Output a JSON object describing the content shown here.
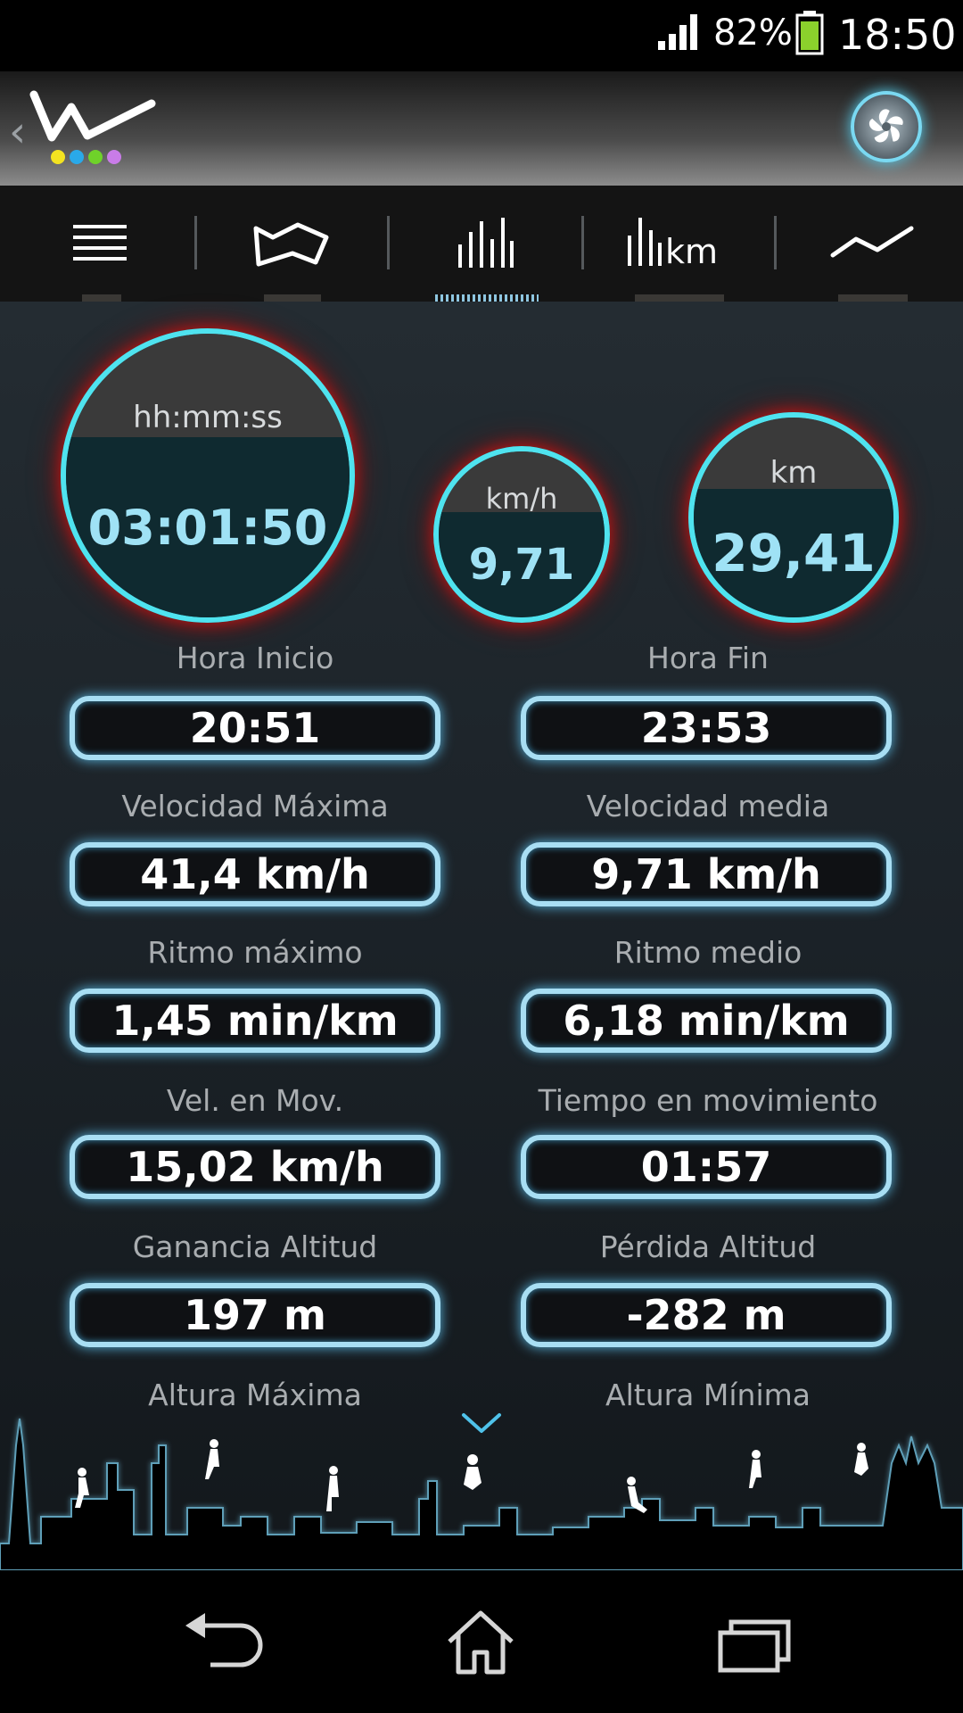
{
  "status_bar": {
    "battery_percent": "82%",
    "time": "18:50"
  },
  "tabs": [
    {
      "name": "list",
      "icon": "list-icon",
      "active": false
    },
    {
      "name": "map",
      "icon": "map-icon",
      "active": false
    },
    {
      "name": "bars",
      "icon": "bar-chart-icon",
      "active": true
    },
    {
      "name": "bars-km",
      "icon": "bar-chart-km-icon",
      "active": false,
      "label": "km"
    },
    {
      "name": "line",
      "icon": "line-chart-icon",
      "active": false
    }
  ],
  "gauges": {
    "time": {
      "unit": "hh:mm:ss",
      "value": "03:01:50"
    },
    "speed": {
      "unit": "km/h",
      "value": "9,71"
    },
    "distance": {
      "unit": "km",
      "value": "29,41"
    }
  },
  "stats": {
    "hora_inicio": {
      "label": "Hora Inicio",
      "value": "20:51"
    },
    "hora_fin": {
      "label": "Hora Fin",
      "value": "23:53"
    },
    "velocidad_maxima": {
      "label": "Velocidad Máxima",
      "value": "41,4 km/h"
    },
    "velocidad_media": {
      "label": "Velocidad media",
      "value": "9,71 km/h"
    },
    "ritmo_maximo": {
      "label": "Ritmo máximo",
      "value": "1,45 min/km"
    },
    "ritmo_medio": {
      "label": "Ritmo medio",
      "value": "6,18 min/km"
    },
    "vel_en_mov": {
      "label": "Vel. en Mov.",
      "value": "15,02 km/h"
    },
    "tiempo_en_movimiento": {
      "label": "Tiempo en movimiento",
      "value": "01:57"
    },
    "ganancia_altitud": {
      "label": "Ganancia Altitud",
      "value": "197 m"
    },
    "perdida_altitud": {
      "label": "Pérdida Altitud",
      "value": "-282 m"
    },
    "altura_maxima": {
      "label": "Altura Máxima"
    },
    "altura_minima": {
      "label": "Altura Mínima"
    }
  },
  "colors": {
    "accent_cyan": "#4fe3ef",
    "glow_red": "#c01818",
    "box_border": "#a8def3",
    "value_text": "#9fe2f5"
  }
}
